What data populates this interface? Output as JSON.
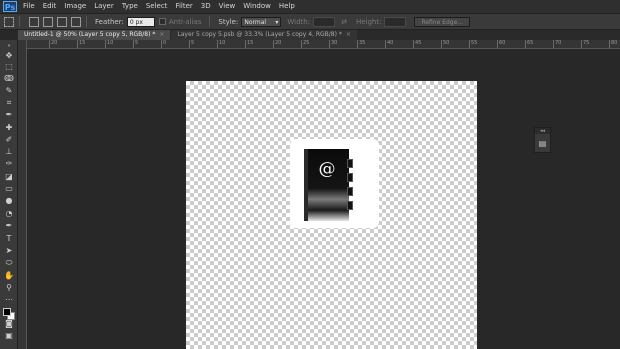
{
  "app": {
    "logo": "Ps"
  },
  "menu": [
    "File",
    "Edit",
    "Image",
    "Layer",
    "Type",
    "Select",
    "Filter",
    "3D",
    "View",
    "Window",
    "Help"
  ],
  "options": {
    "feather_label": "Feather:",
    "feather_value": "0 px",
    "antialias_label": "Anti-alias",
    "style_label": "Style:",
    "style_value": "Normal",
    "width_label": "Width:",
    "height_label": "Height:",
    "refine_label": "Refine Edge..."
  },
  "tabs": [
    {
      "label": "Untitled-1 @ 50% (Layer 5 copy 5, RGB/8) *",
      "close": "×"
    },
    {
      "label": "Layer 5 copy 5.psb @ 33.3% (Layer 5 copy 4, RGB/8) *",
      "close": "×"
    }
  ],
  "ruler": {
    "labels": [
      "20",
      "15",
      "10",
      "5",
      "0",
      "5",
      "10",
      "15",
      "20",
      "25",
      "30",
      "35",
      "40",
      "45",
      "50",
      "55",
      "60",
      "65",
      "70",
      "75",
      "80"
    ]
  },
  "document": {
    "glyph": "@"
  },
  "panel": {
    "collapse_label": "◂◂"
  },
  "colors": {
    "accent": "#53a8ff",
    "workspace": "#282828",
    "panel": "#3a3a3a"
  }
}
